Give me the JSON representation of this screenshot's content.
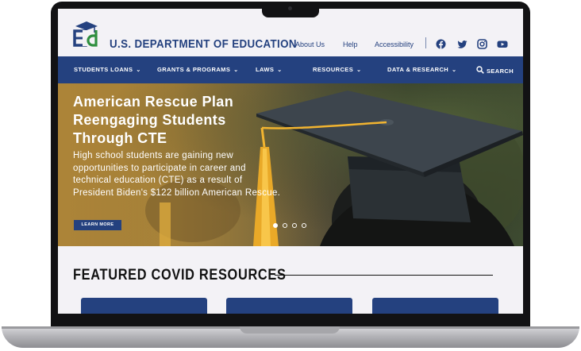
{
  "header": {
    "agency_name": "U.S. DEPARTMENT OF EDUCATION",
    "utility_links": [
      "About Us",
      "Help",
      "Accessibility"
    ],
    "social_icons": [
      "facebook-icon",
      "twitter-icon",
      "instagram-icon",
      "youtube-icon"
    ]
  },
  "nav": {
    "items": [
      "STUDENTS LOANS",
      "GRANTS & PROGRAMS",
      "LAWS",
      "RESOURCES",
      "DATA & RESEARCH"
    ],
    "search_label": "SEARCH"
  },
  "hero": {
    "title": "American Rescue Plan Reengaging Students Through CTE",
    "body": "High school students are gaining new opportunities to participate in career and technical education (CTE) as a result of President Biden's $122 billion American Rescue.",
    "button_label": "LEARN MORE",
    "slide_count": 4,
    "active_slide": 1
  },
  "featured": {
    "title": "FEATURED COVID RESOURCES",
    "card_count": 3
  },
  "colors": {
    "brand_blue": "#24417f",
    "background": "#f3f2f6",
    "tassel_gold": "#f2b430"
  }
}
